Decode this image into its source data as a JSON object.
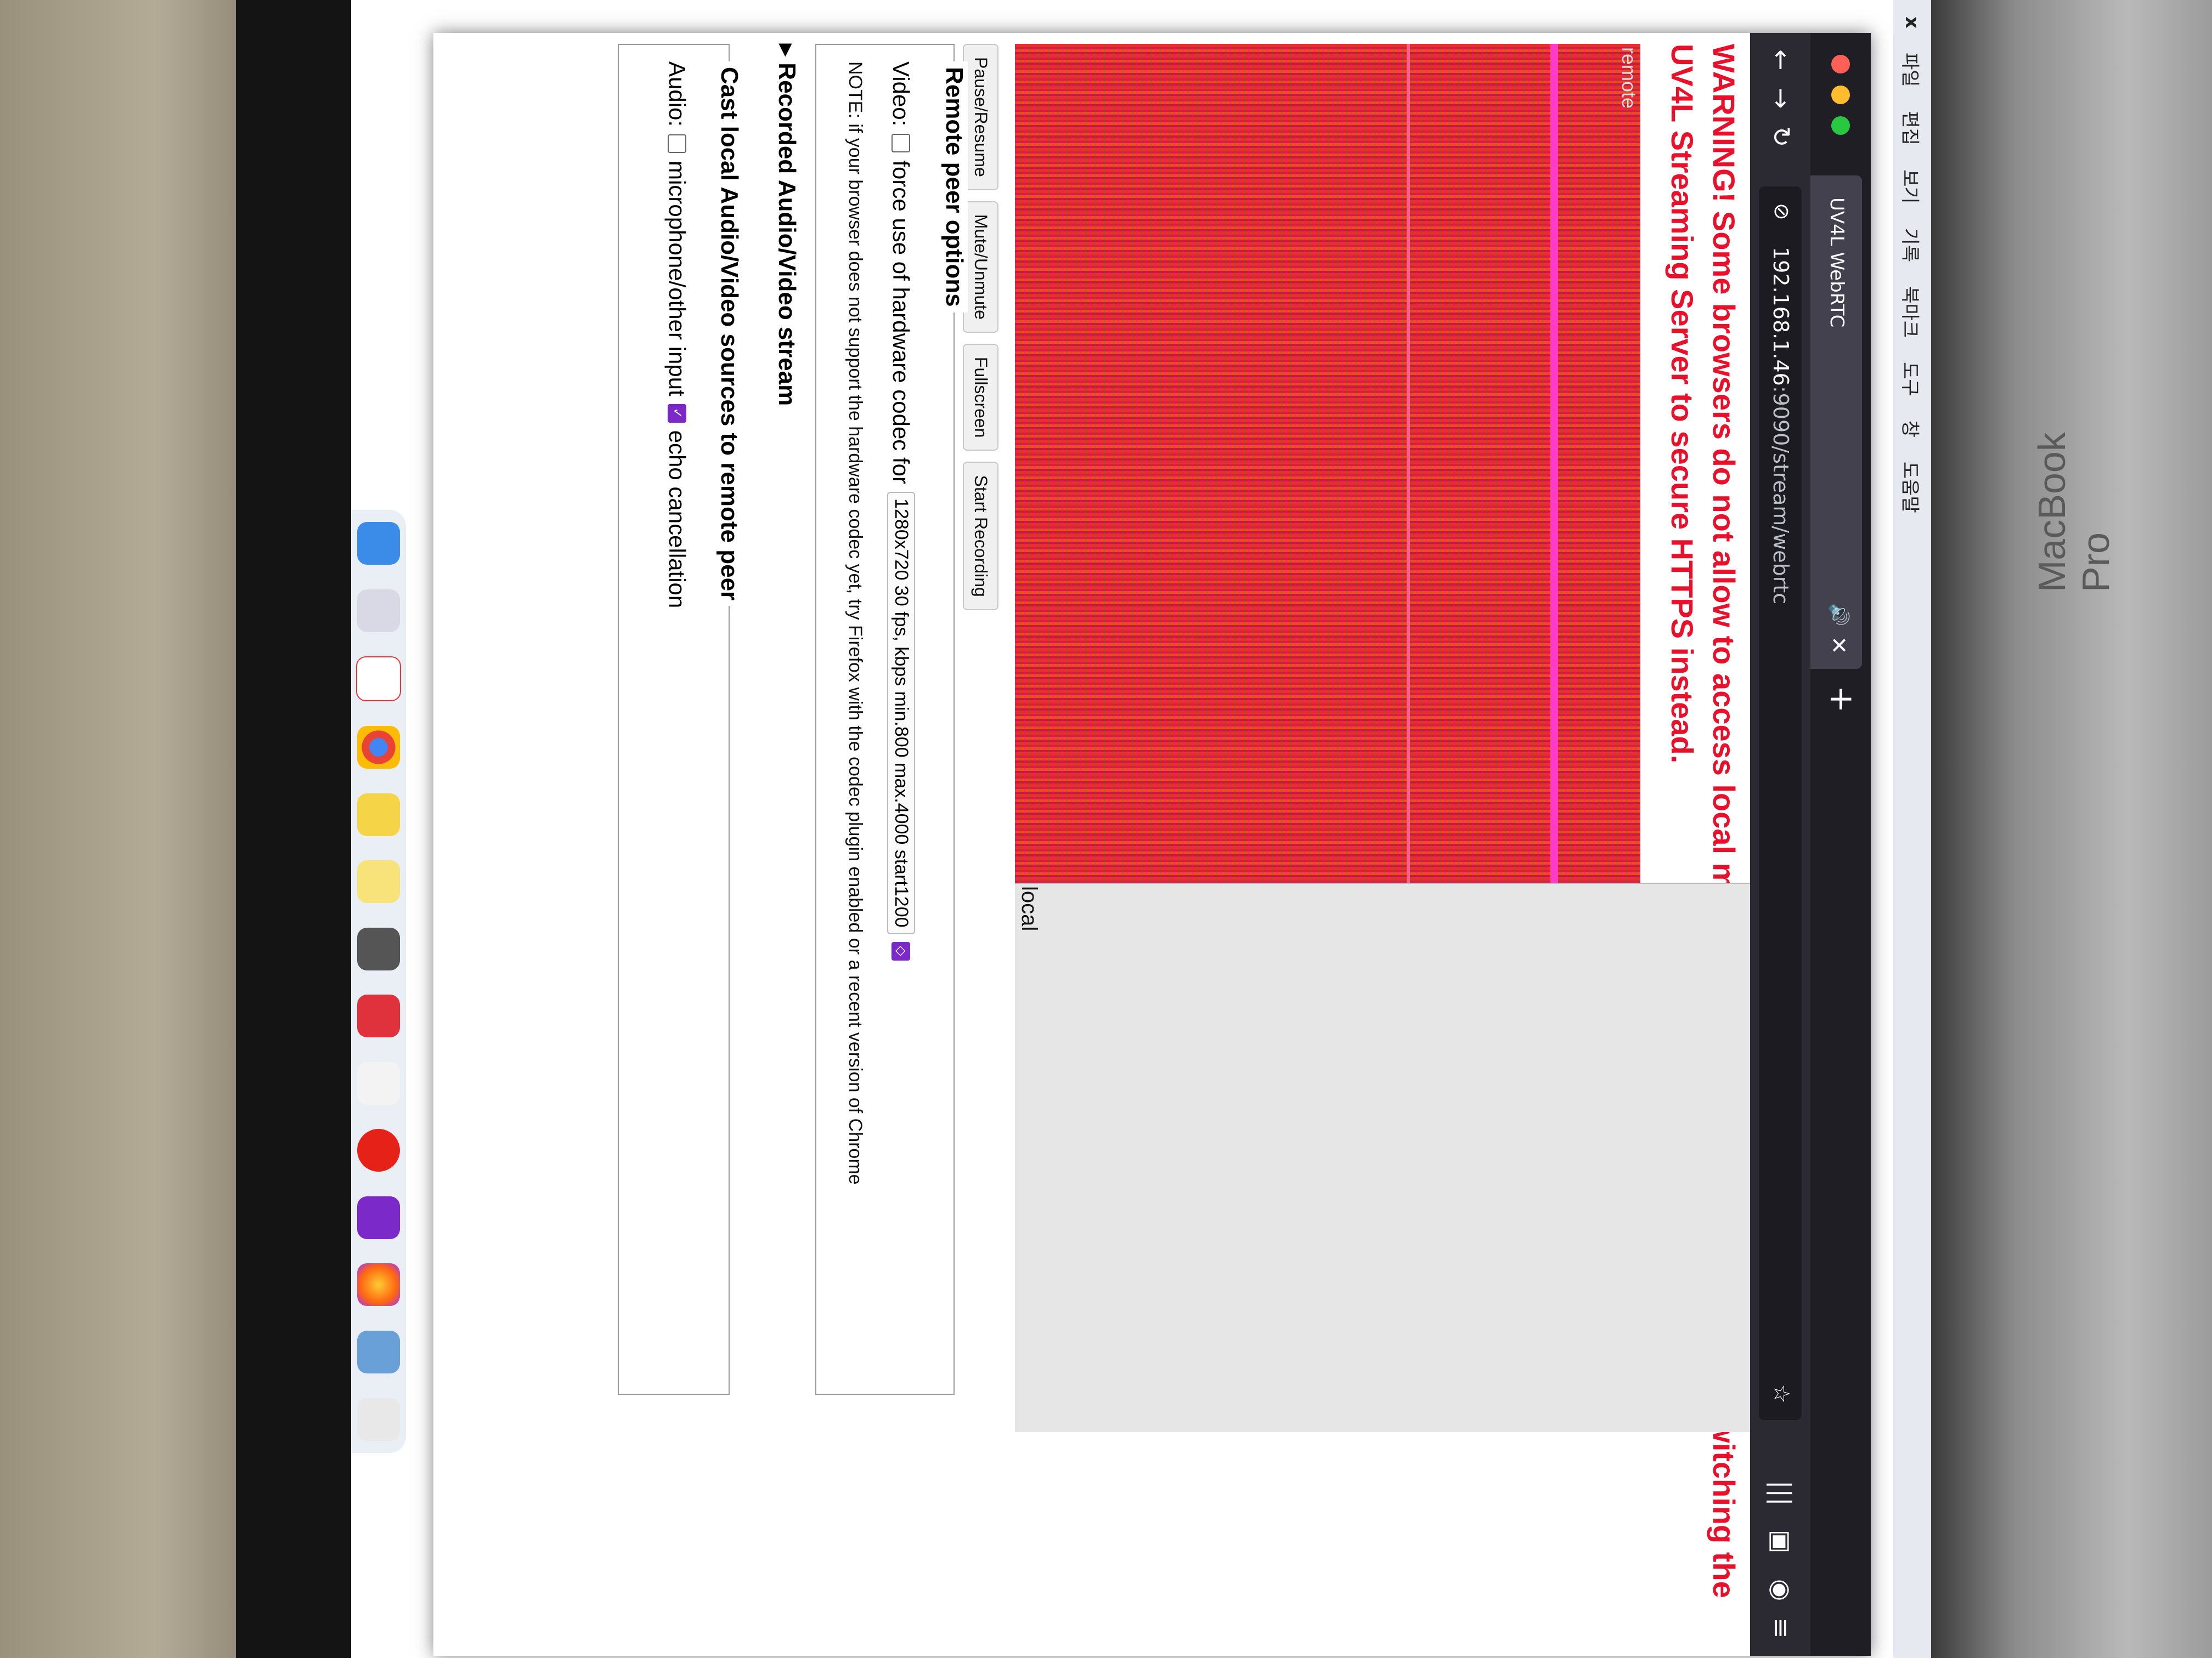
{
  "device": {
    "brand_label": "MacBook Pro"
  },
  "menubar": {
    "items": [
      "파일",
      "편집",
      "보기",
      "기록",
      "북마크",
      "도구",
      "창",
      "도움말"
    ]
  },
  "tab": {
    "title": "UV4L WebRTC",
    "sound_icon": "🔊",
    "close": "✕"
  },
  "url": {
    "host": "192.168.1.46",
    "path": ":9090/stream/webrtc"
  },
  "page": {
    "warning": "WARNING! Some browsers do not allow to access local media on insecure origins. Consider switching the UV4L Streaming Server to secure HTTPS instead.",
    "remote_label": "remote",
    "local_label": "local",
    "buttons": [
      "Pause/Resume",
      "Mute/Unmute",
      "Fullscreen",
      "Start Recording"
    ],
    "remote_options": {
      "legend": "Remote peer options",
      "video_label": "Video:",
      "hw_codec_label": "force use of hardware codec for",
      "resolution_select": "1280x720 30 fps, kbps min.800 max.4000 start1200",
      "note": "NOTE: if your browser does not support the hardware codec yet, try Firefox with the codec plugin enabled or a recent version of Chrome"
    },
    "recorded_toggle": "▸ Recorded Audio/Video stream",
    "cast": {
      "legend": "Cast local Audio/Video sources to remote peer",
      "audio_label": "Audio:",
      "mic_label": "microphone/other input",
      "echo_label": "echo cancellation"
    }
  },
  "colors": {
    "warning": "#e8102a",
    "tabbar": "#1f1e25",
    "checkbox_on": "#7b2ac9"
  },
  "dock_icons": [
    "finder-icon",
    "launchpad-icon",
    "calendar-icon",
    "chrome-icon",
    "notes-icon",
    "stickies-icon",
    "calculator-icon",
    "word-icon",
    "drive-icon",
    "youtube-icon",
    "onenote-icon",
    "firefox-icon",
    "preview-icon",
    "trash-icon"
  ]
}
